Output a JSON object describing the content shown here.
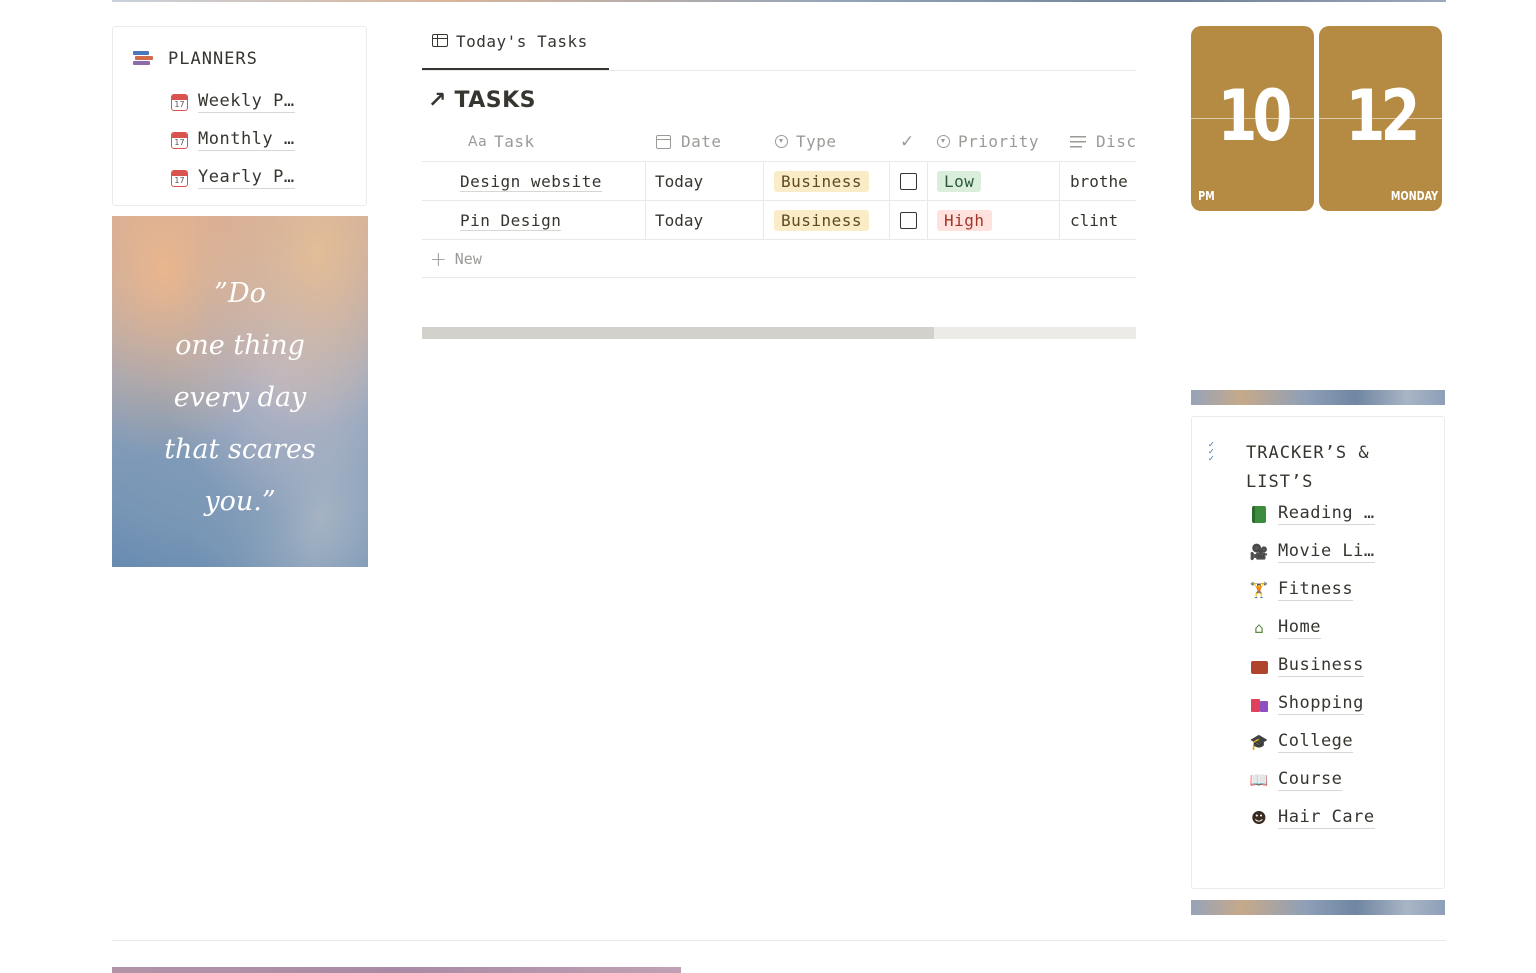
{
  "planners": {
    "title": "PLANNERS",
    "items": [
      {
        "label": "Weekly P…"
      },
      {
        "label": "Monthly …"
      },
      {
        "label": "Yearly P…"
      }
    ],
    "calendar_day": "17"
  },
  "quote": {
    "lines": [
      "”Do",
      "one thing",
      "every day",
      "that scares",
      "you.”"
    ]
  },
  "tasks": {
    "tab_label": "Today's Tasks",
    "title": "TASKS",
    "columns": {
      "task": "Task",
      "task_prefix": "Aa",
      "date": "Date",
      "type": "Type",
      "priority": "Priority",
      "description": "Disc"
    },
    "rows": [
      {
        "task": "Design website",
        "date": "Today",
        "type": "Business",
        "done": false,
        "priority": "Low",
        "desc": "brothe"
      },
      {
        "task": "Pin Design",
        "date": "Today",
        "type": "Business",
        "done": false,
        "priority": "High",
        "desc": "clint"
      }
    ],
    "new_label": "New",
    "scroll_fraction": 0.717
  },
  "clock": {
    "hour": "10",
    "minute": "12",
    "period": "PM",
    "day": "MONDAY",
    "color": "#b58a42"
  },
  "tracker": {
    "title": "TRACKER’S  & LIST’S",
    "items": [
      {
        "label": "Reading …",
        "icon": "green-book-icon"
      },
      {
        "label": "Movie Li…",
        "icon": "movie-camera-icon"
      },
      {
        "label": "Fitness",
        "icon": "weight-lifter-icon"
      },
      {
        "label": "Home",
        "icon": "house-icon"
      },
      {
        "label": "Business",
        "icon": "briefcase-icon"
      },
      {
        "label": "Shopping",
        "icon": "shopping-bags-icon"
      },
      {
        "label": "College",
        "icon": "graduation-cap-icon"
      },
      {
        "label": "Course",
        "icon": "open-book-icon"
      },
      {
        "label": "Hair Care",
        "icon": "haircut-icon"
      }
    ]
  },
  "colors": {
    "business": "#fbecc8",
    "low": "#dbeddb",
    "high": "#ffe2dd"
  }
}
